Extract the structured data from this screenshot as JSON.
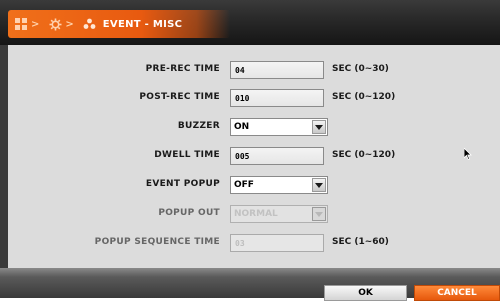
{
  "header": {
    "title": "EVENT - MISC",
    "breadcrumb_icons": [
      "grid-icon",
      "gear-icon",
      "event-icon"
    ],
    "accent": "#f0701a"
  },
  "form": {
    "pre_rec_time": {
      "label": "PRE-REC TIME",
      "value": "04",
      "unit": "SEC (0~30)"
    },
    "post_rec_time": {
      "label": "POST-REC TIME",
      "value": "010",
      "unit": "SEC (0~120)"
    },
    "buzzer": {
      "label": "BUZZER",
      "value": "ON"
    },
    "dwell_time": {
      "label": "DWELL TIME",
      "value": "005",
      "unit": "SEC (0~120)"
    },
    "event_popup": {
      "label": "EVENT POPUP",
      "value": "OFF"
    },
    "popup_out": {
      "label": "POPUP OUT",
      "value": "NORMAL"
    },
    "popup_sequence_time": {
      "label": "POPUP SEQUENCE TIME",
      "value": "03",
      "unit": "SEC (1~60)"
    }
  },
  "buttons": {
    "ok": "OK",
    "cancel": "CANCEL"
  }
}
